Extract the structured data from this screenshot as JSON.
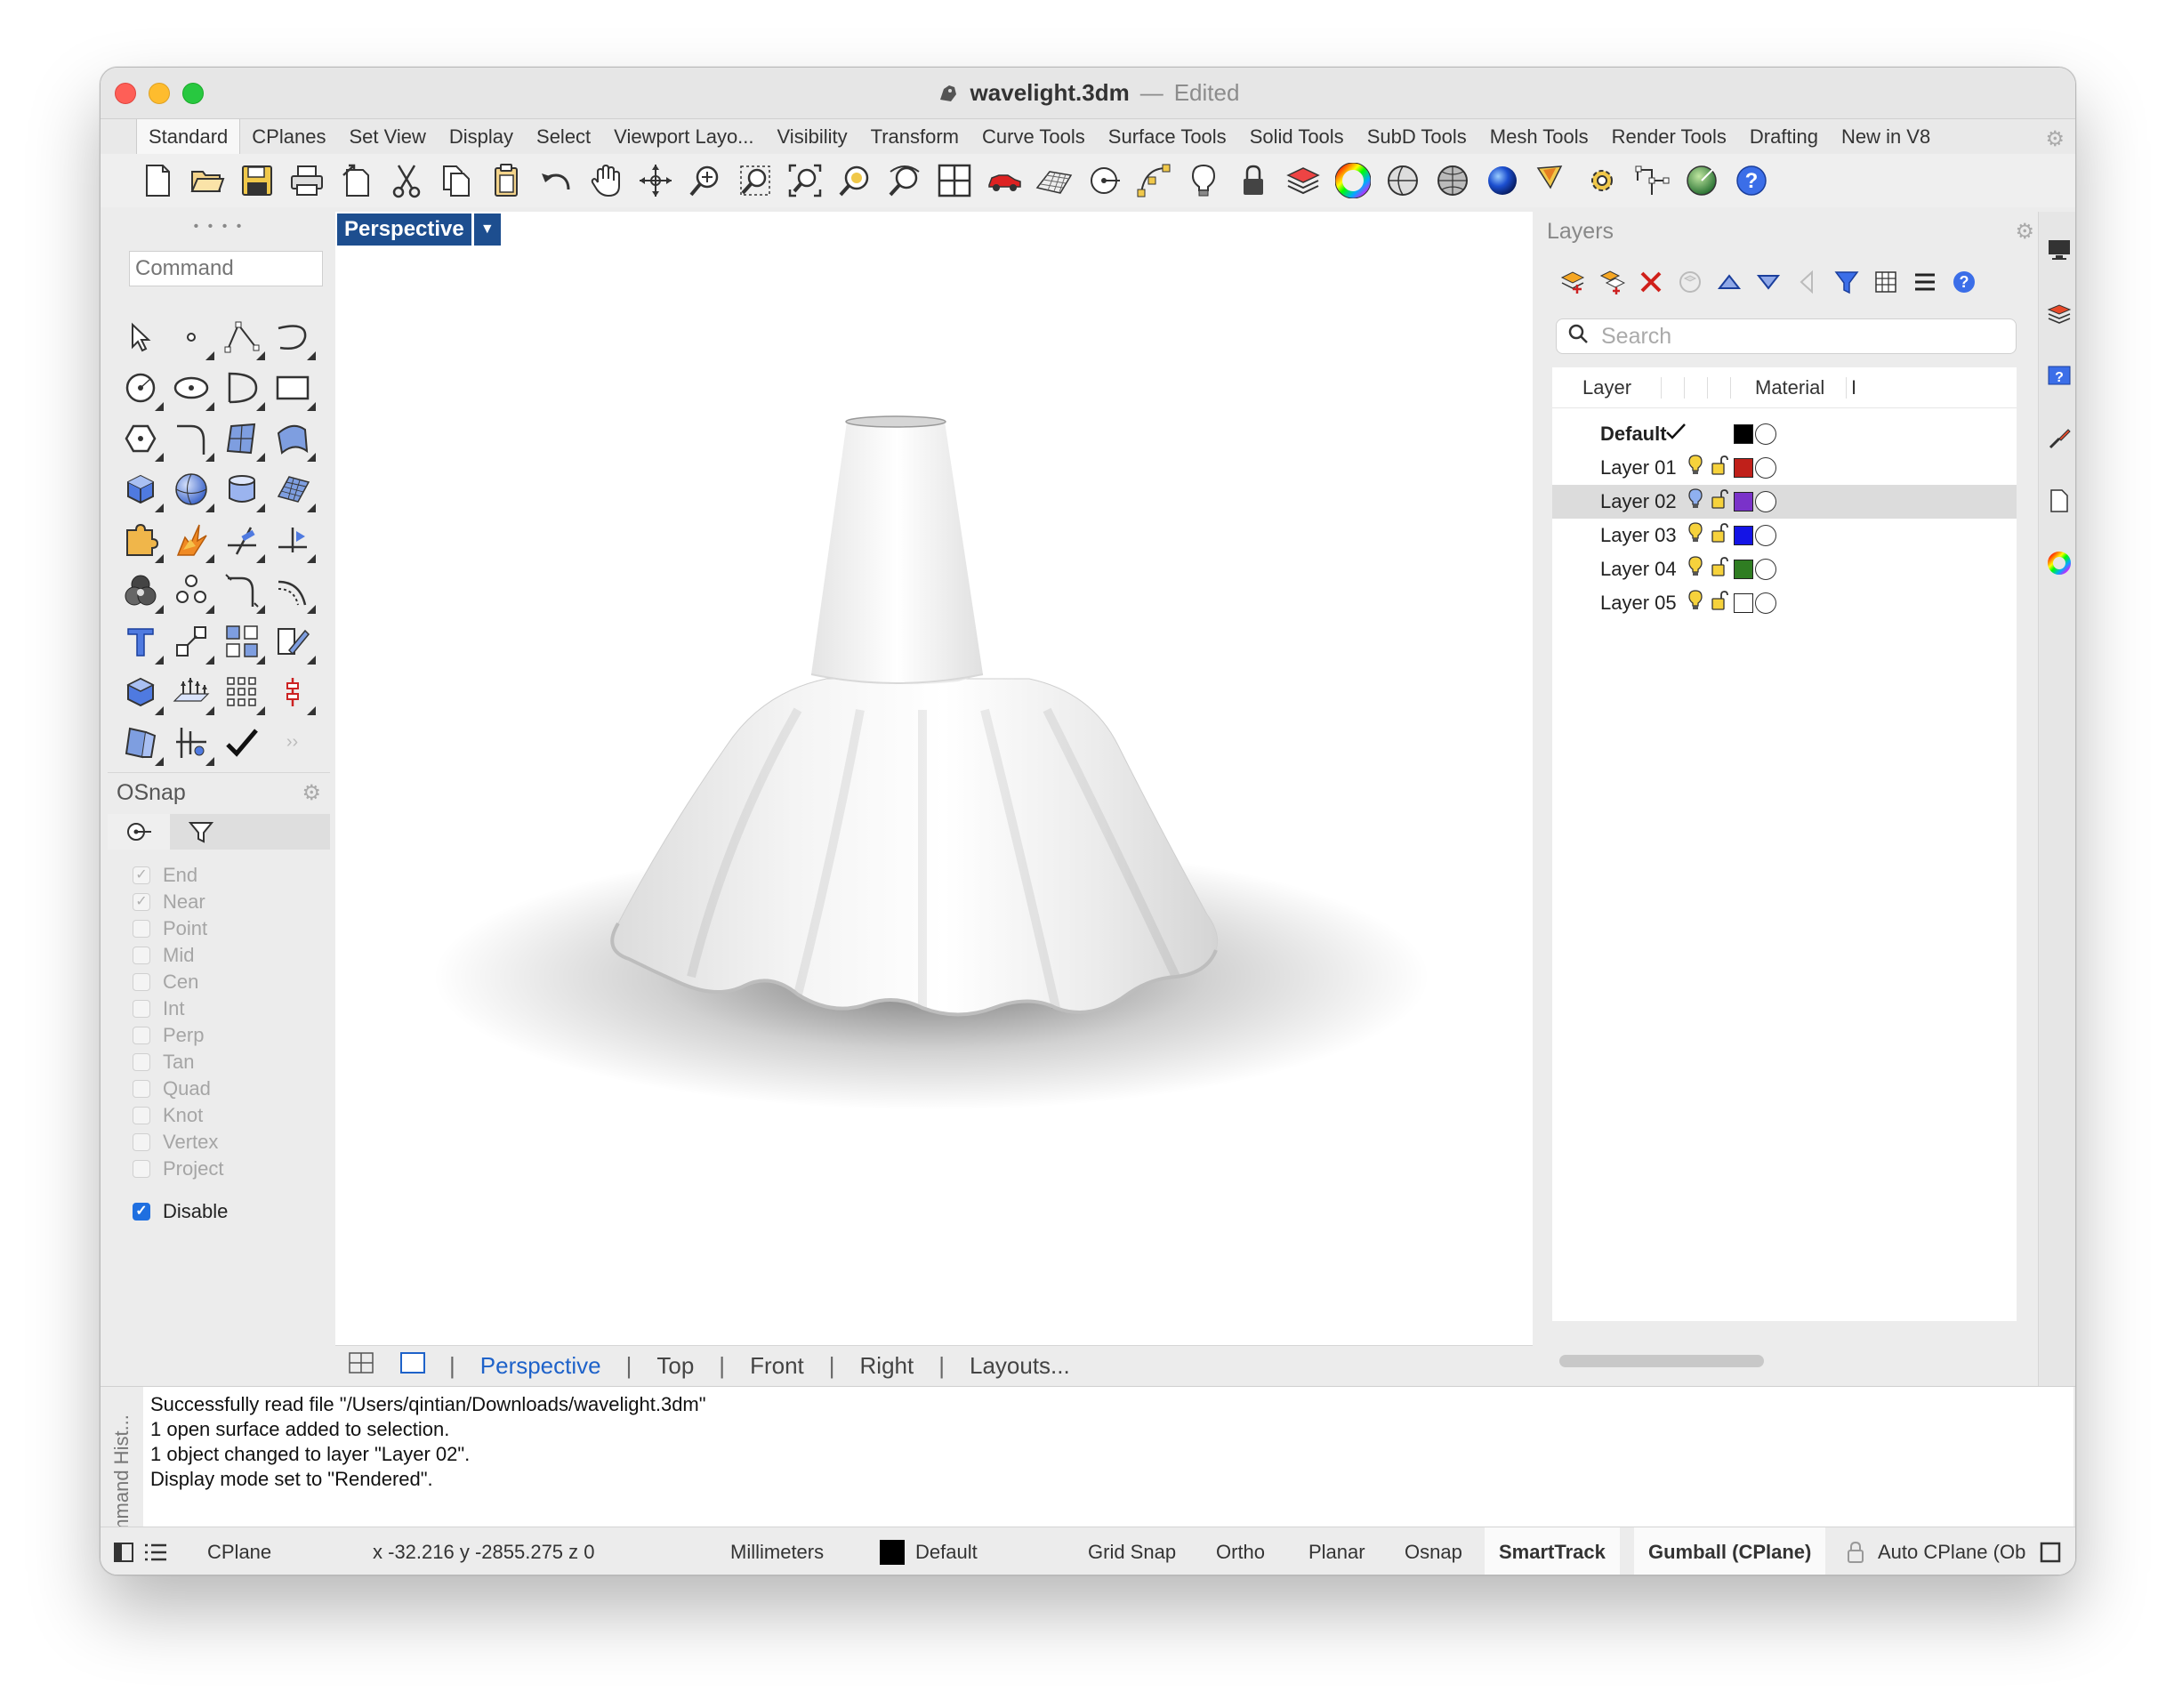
{
  "window": {
    "file_name": "wavelight.3dm",
    "separator": "—",
    "status": "Edited"
  },
  "tabs": [
    "Standard",
    "CPlanes",
    "Set View",
    "Display",
    "Select",
    "Viewport Layo...",
    "Visibility",
    "Transform",
    "Curve Tools",
    "Surface Tools",
    "Solid Tools",
    "SubD Tools",
    "Mesh Tools",
    "Render Tools",
    "Drafting",
    "New in V8"
  ],
  "toolbar_icons": [
    "new-document-icon",
    "open-folder-icon",
    "save-icon",
    "print-icon",
    "import-icon",
    "cut-icon",
    "copy-icon",
    "paste-icon",
    "undo-icon",
    "pan-hand-icon",
    "rotate-view-icon",
    "zoom-icon",
    "zoom-window-icon",
    "zoom-extents-icon",
    "zoom-selected-icon",
    "rotate-camera-icon",
    "four-viewports-icon",
    "car-render-icon",
    "grid-plane-icon",
    "point-snap-icon",
    "control-points-icon",
    "light-bulb-icon",
    "lock-icon",
    "layer-icon",
    "color-wheel-icon",
    "sphere-shaded-icon",
    "sphere-wireframe-icon",
    "sphere-render-icon",
    "spotlight-icon",
    "gear-settings-icon",
    "dimension-icon",
    "globe-icon",
    "help-icon"
  ],
  "command": {
    "placeholder": "Command"
  },
  "tool_icons": [
    "select-arrow-icon",
    "point-icon",
    "polyline-icon",
    "curve-icon",
    "circle-icon",
    "ellipse-icon",
    "arc-icon",
    "rectangle-icon",
    "polygon-icon",
    "fillet-curve-icon",
    "surface-icon",
    "sweep-surface-icon",
    "box-icon",
    "sphere-icon",
    "cylinder-icon",
    "mesh-plane-icon",
    "puzzle-icon",
    "explode-icon",
    "trim-icon",
    "split-icon",
    "boolean-icon",
    "array-icon",
    "fillet-icon",
    "offset-icon",
    "text-icon",
    "scale-icon",
    "move-icon",
    "edit-icon",
    "solid-box-icon",
    "heights-icon",
    "grid-array-icon",
    "gumball-icon",
    "cage-icon",
    "snap-tool-icon",
    "check-icon",
    "more-icon"
  ],
  "osnap": {
    "title": "OSnap",
    "items": [
      {
        "label": "End",
        "checked": true
      },
      {
        "label": "Near",
        "checked": true
      },
      {
        "label": "Point",
        "checked": false
      },
      {
        "label": "Mid",
        "checked": false
      },
      {
        "label": "Cen",
        "checked": false
      },
      {
        "label": "Int",
        "checked": false
      },
      {
        "label": "Perp",
        "checked": false
      },
      {
        "label": "Tan",
        "checked": false
      },
      {
        "label": "Quad",
        "checked": false
      },
      {
        "label": "Knot",
        "checked": false
      },
      {
        "label": "Vertex",
        "checked": false
      },
      {
        "label": "Project",
        "checked": false
      }
    ],
    "disable_label": "Disable",
    "disable_checked": true
  },
  "viewport": {
    "name": "Perspective"
  },
  "viewport_tabs": {
    "perspective": "Perspective",
    "top": "Top",
    "front": "Front",
    "right": "Right",
    "layouts": "Layouts..."
  },
  "layers": {
    "title": "Layers",
    "search_placeholder": "Search",
    "col_layer": "Layer",
    "col_material": "Material",
    "col_extra": "I",
    "rows": [
      {
        "name": "Default",
        "current": true,
        "color": "#000000",
        "bold": true
      },
      {
        "name": "Layer 01",
        "current": false,
        "color": "#c0201a",
        "bold": false
      },
      {
        "name": "Layer 02",
        "current": false,
        "color": "#7a32c9",
        "bold": false,
        "selected": true
      },
      {
        "name": "Layer 03",
        "current": false,
        "color": "#1414e6",
        "bold": false
      },
      {
        "name": "Layer 04",
        "current": false,
        "color": "#2f7d22",
        "bold": false
      },
      {
        "name": "Layer 05",
        "current": false,
        "color": "#ffffff",
        "bold": false
      }
    ]
  },
  "history": {
    "label": "Command Hist...",
    "lines": [
      "Successfully read file \"/Users/qintian/Downloads/wavelight.3dm\"",
      "1 open surface added to selection.",
      "1 object changed to layer \"Layer 02\".",
      "Display mode set to \"Rendered\"."
    ]
  },
  "status_bar": {
    "cplane": "CPlane",
    "coords": "x -32.216  y -2855.275  z 0",
    "units": "Millimeters",
    "layer": "Default",
    "layer_color": "#000000",
    "grid_snap": "Grid Snap",
    "ortho": "Ortho",
    "planar": "Planar",
    "osnap": "Osnap",
    "smarttrack": "SmartTrack",
    "gumball": "Gumball (CPlane)",
    "auto_cplane": "Auto CPlane (Ob"
  }
}
